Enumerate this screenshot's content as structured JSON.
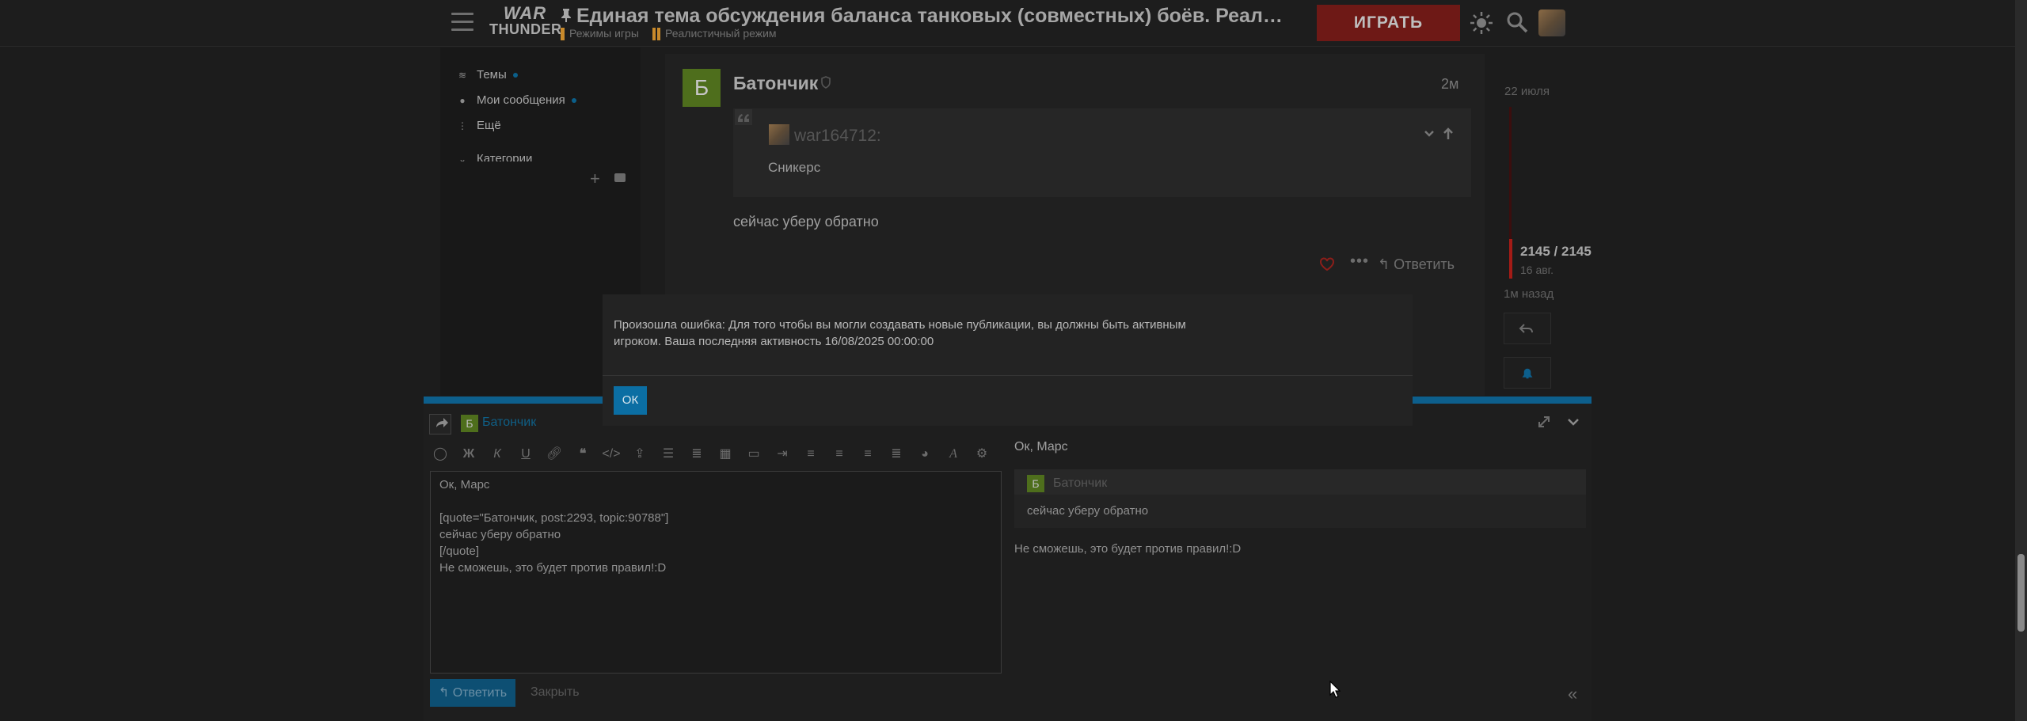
{
  "header": {
    "logo_line1": "WAR",
    "logo_line2": "THUNDER",
    "topic_title": "Единая тема обсуждения баланса танковых (совместных) боёв. Реалистичн…",
    "category1": "Режимы игры",
    "category2": "Реалистичный режим",
    "category1_color": "#c98a2b",
    "category2_color": "#c98a2b",
    "play_label": "ИГРАТЬ",
    "play_color": "#8c1e1a"
  },
  "sidebar": {
    "items": [
      {
        "label": "Темы",
        "icon": "layers-icon"
      },
      {
        "label": "Мои сообщения",
        "icon": "user-icon"
      },
      {
        "label": "Ещё",
        "icon": "more-vertical-icon"
      },
      {
        "label": "Категории",
        "icon": "chevron-down-icon"
      }
    ]
  },
  "post": {
    "avatar_letter": "Б",
    "avatar_color": "#4e6e1c",
    "author": "Батончик",
    "time": "2м",
    "quote": {
      "user": "war164712:",
      "text": "Сникерс"
    },
    "body": "сейчас уберу обратно",
    "reply_label": "Ответить"
  },
  "timeline": {
    "date": "22 июля",
    "count": "2145 / 2145",
    "sub": "16 авг.",
    "ago": "1м назад"
  },
  "composer": {
    "reply_to_letter": "Б",
    "reply_to_name": "Батончик",
    "editor_lines": [
      "Ок, Марс",
      "",
      "[quote=\"Батончик, post:2293, topic:90788\"]",
      "сейчас уберу обратно",
      "[/quote]",
      "Не сможешь, это будет против правил!:D"
    ],
    "toolbar_icons": [
      "speech-bubble-icon",
      "bold-icon",
      "italic-icon",
      "underline-icon",
      "link-icon",
      "blockquote-icon",
      "code-icon",
      "upload-icon",
      "bullet-list-icon",
      "numbered-list-icon",
      "calendar-icon",
      "image-icon",
      "indent-icon",
      "align-left-icon",
      "align-center-icon",
      "align-right-icon",
      "justify-icon",
      "palette-icon",
      "font-icon",
      "gear-icon"
    ],
    "toolbar_labels": [
      "",
      "Ж",
      "К",
      "U"
    ],
    "preview": {
      "title": "Ок, Марс",
      "quote_letter": "Б",
      "quote_name": "Батончик",
      "quote_text": "сейчас уберу обратно",
      "body": "Не сможешь, это будет против правил!:D"
    },
    "submit_label": "Ответить",
    "close_label": "Закрыть",
    "accent": "#0d5f8c"
  },
  "modal": {
    "message_line1": "Произошла ошибка: Для того чтобы вы могли создавать новые публикации, вы должны быть активным",
    "message_line2": "игроком. Ваша последняя активность 16/08/2025 00:00:00",
    "ok_label": "ОК"
  }
}
